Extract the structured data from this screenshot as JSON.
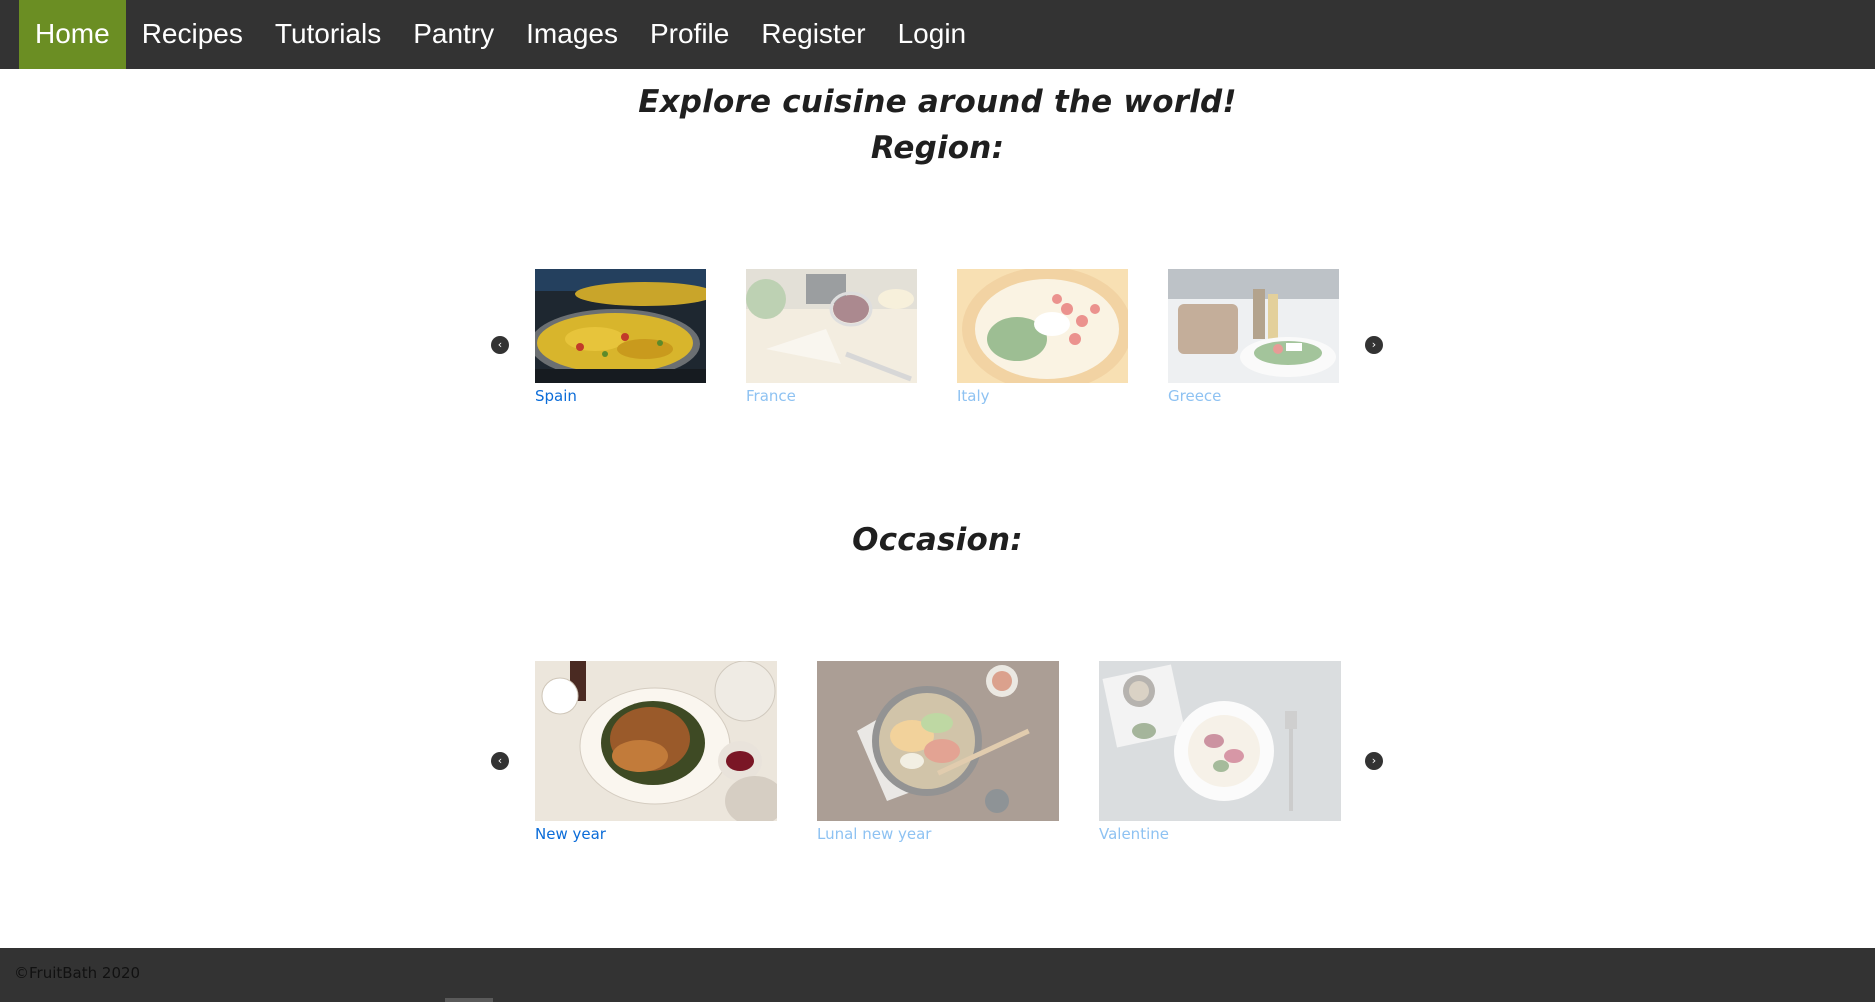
{
  "nav": {
    "items": [
      "Home",
      "Recipes",
      "Tutorials",
      "Pantry",
      "Images",
      "Profile",
      "Register",
      "Login"
    ],
    "active": "Home"
  },
  "headings": {
    "explore": "Explore cuisine around the world!",
    "region": "Region:",
    "occasion": "Occasion:"
  },
  "region": {
    "cards": [
      {
        "label": "Spain",
        "image": "paella-pans"
      },
      {
        "label": "France",
        "image": "cheese-and-wine"
      },
      {
        "label": "Italy",
        "image": "pizza-caprese"
      },
      {
        "label": "Greece",
        "image": "greek-salad-table"
      }
    ]
  },
  "occasion": {
    "cards": [
      {
        "label": "New year",
        "image": "roast-duck-platter"
      },
      {
        "label": "Lunal new year",
        "image": "vegetable-bowl"
      },
      {
        "label": "Valentine",
        "image": "plated-dish"
      }
    ]
  },
  "controls": {
    "prev_icon": "‹",
    "next_icon": "›"
  },
  "footer": {
    "text": "©FruitBath 2020"
  },
  "colors": {
    "nav_bg": "#333333",
    "active_tab": "#6b8e23",
    "link": "#0b6cd8",
    "footer_bg": "#333333"
  }
}
